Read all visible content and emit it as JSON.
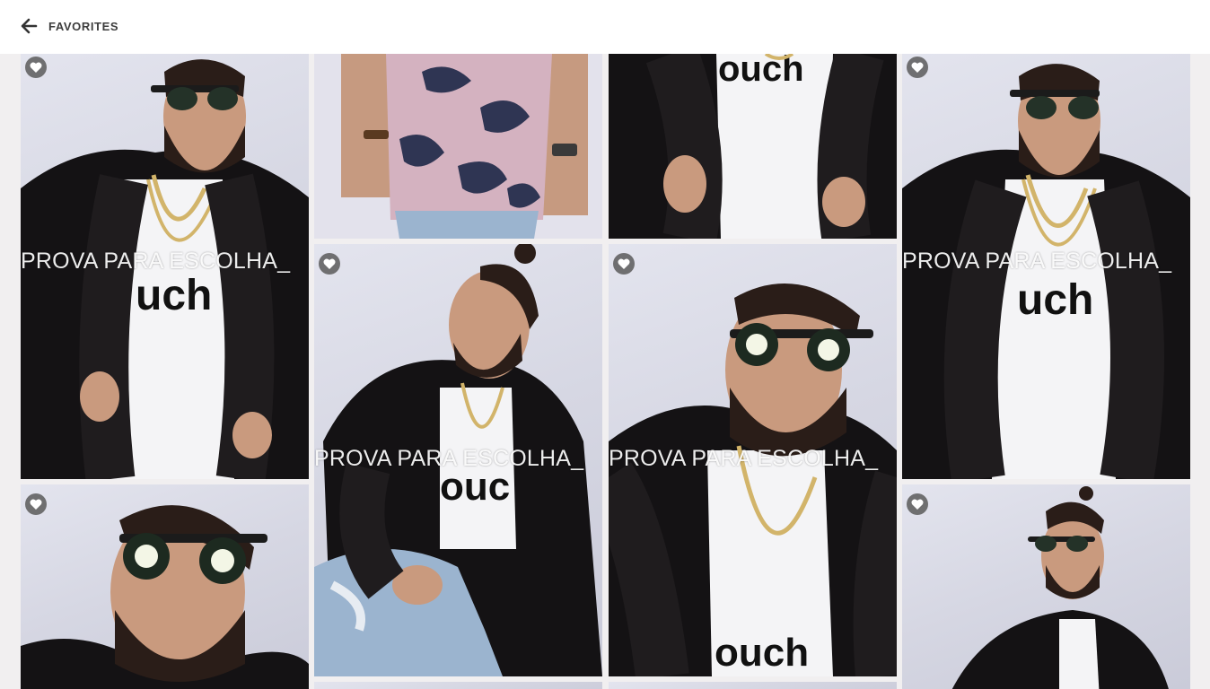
{
  "header": {
    "title": "FAVORITES",
    "back_icon": "arrow-left-icon"
  },
  "watermark_text": "PROVA PARA ESCOLHA_",
  "colors": {
    "header_bg": "#ffffff",
    "page_bg": "#f1eff0",
    "title_text": "#3d3d3d",
    "fav_badge": "#5a5a5a",
    "backdrop": "#d6d7e3",
    "coat": "#141214",
    "shirt": "#f4f4f6",
    "skin": "#c99a7e",
    "beard": "#2a1d18",
    "camo_pink": "#d4b2c0",
    "camo_navy": "#2f3553",
    "jeans": "#9bb4cf",
    "chain": "#d2b46a"
  },
  "gallery": {
    "photos": [
      {
        "subject": "man in fur coat and sunglasses, front view",
        "favorite_icon": true,
        "watermark": true
      },
      {
        "subject": "pink camouflage tee with jeans, torso",
        "favorite_icon": false,
        "watermark": false
      },
      {
        "subject": "fur coat over white printed tee, torso",
        "favorite_icon": false,
        "watermark": false
      },
      {
        "subject": "man in fur coat and sunglasses, front view",
        "favorite_icon": true,
        "watermark": true
      },
      {
        "subject": "man crouching in fur coat, looking aside",
        "favorite_icon": true,
        "watermark": true
      },
      {
        "subject": "man in sunglasses looking up, close-up",
        "favorite_icon": true,
        "watermark": true
      },
      {
        "subject": "man in sunglasses, head tilted, close-up",
        "favorite_icon": true,
        "watermark": false
      },
      {
        "subject": "man in fur coat looking down, sunglasses",
        "favorite_icon": true,
        "watermark": false
      },
      {
        "subject": "next photo, partially visible",
        "favorite_icon": false,
        "watermark": false
      },
      {
        "subject": "next photo, partially visible",
        "favorite_icon": false,
        "watermark": false
      }
    ]
  }
}
